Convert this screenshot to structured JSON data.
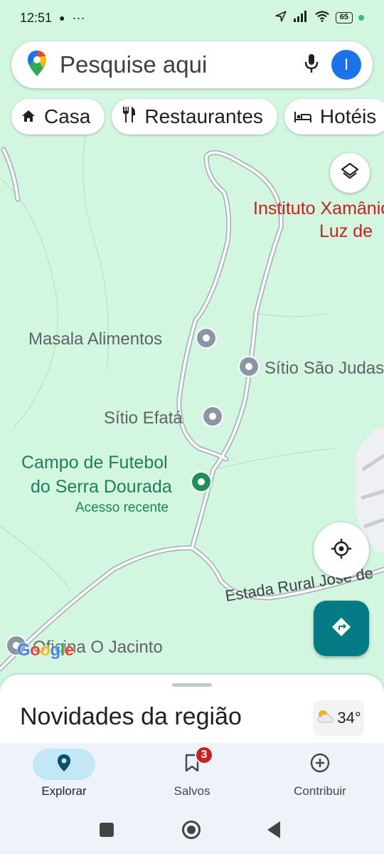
{
  "status_bar": {
    "time": "12:51",
    "battery": "65"
  },
  "search": {
    "placeholder": "Pesquise aqui",
    "avatar_initial": "I",
    "icons": [
      "maps-pin-icon",
      "mic-icon"
    ]
  },
  "chips": [
    {
      "label": "Casa",
      "icon": "home-icon"
    },
    {
      "label": "Restaurantes",
      "icon": "fork-knife-icon"
    },
    {
      "label": "Hotéis",
      "icon": "bed-icon"
    }
  ],
  "map": {
    "places": {
      "instituto_line1": "Instituto Xamânico",
      "instituto_line2": "Luz de",
      "masala": "Masala Alimentos",
      "sitio_sao": "Sítio São Judas",
      "sitio_efata": "Sítio Efatá",
      "campo_line1": "Campo de Futebol",
      "campo_line2": "do Serra Dourada",
      "campo_sub": "Acesso recente",
      "oficina": "Oficina O Jacinto"
    },
    "road_label": "Estada Rural Jose de",
    "logo": "Google"
  },
  "sheet": {
    "title": "Novidades da região",
    "temperature": "34°",
    "weather_icon": "partly-cloudy-icon"
  },
  "nav": [
    {
      "label": "Explorar",
      "icon": "explore-pin-icon",
      "active": true
    },
    {
      "label": "Salvos",
      "icon": "bookmark-icon",
      "badge": "3"
    },
    {
      "label": "Contribuir",
      "icon": "add-circle-icon"
    }
  ],
  "colors": {
    "map_bg": "#d3f6e0",
    "accent_teal": "#047b84",
    "place_red": "#c5221f",
    "place_green": "#1e8e5a"
  }
}
